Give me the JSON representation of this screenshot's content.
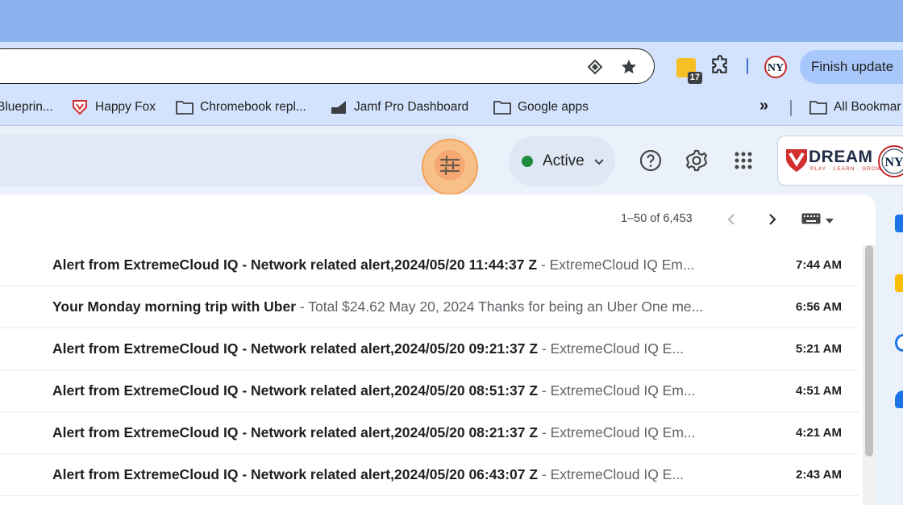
{
  "browser": {
    "finish_update_label": "Finish update",
    "calendar_badge_count": "17",
    "bookmarks": [
      {
        "label": "Blueprin...",
        "icon": "none"
      },
      {
        "label": "Happy Fox",
        "icon": "happyfox-shield-icon"
      },
      {
        "label": "Chromebook repl...",
        "icon": "folder-icon"
      },
      {
        "label": "Jamf Pro Dashboard",
        "icon": "jamf-icon"
      },
      {
        "label": "Google apps",
        "icon": "folder-icon"
      },
      {
        "label": "All Bookmar",
        "icon": "folder-icon"
      }
    ],
    "overflow_label": "»"
  },
  "gmail": {
    "status_label": "Active",
    "status_color": "#1e8e3e",
    "brand_name": "DREAM",
    "brand_tagline": "PLAY · LEARN · GROW",
    "pagination": "1–50 of 6,453",
    "emails": [
      {
        "subject": "Alert from ExtremeCloud IQ - Network related alert,2024/05/20 11:44:37 Z",
        "preview": " - ExtremeCloud IQ Em...",
        "time": "7:44 AM"
      },
      {
        "subject": "Your Monday morning trip with Uber",
        "preview": " - Total $24.62 May 20, 2024 Thanks for being an Uber One me...",
        "time": "6:56 AM"
      },
      {
        "subject": "Alert from ExtremeCloud IQ - Network related alert,2024/05/20 09:21:37 Z",
        "preview": " - ExtremeCloud IQ E...",
        "time": "5:21 AM"
      },
      {
        "subject": "Alert from ExtremeCloud IQ - Network related alert,2024/05/20 08:51:37 Z",
        "preview": " - ExtremeCloud IQ Em...",
        "time": "4:51 AM"
      },
      {
        "subject": "Alert from ExtremeCloud IQ - Network related alert,2024/05/20 08:21:37 Z",
        "preview": " - ExtremeCloud IQ Em...",
        "time": "4:21 AM"
      },
      {
        "subject": "Alert from ExtremeCloud IQ - Network related alert,2024/05/20 06:43:07 Z",
        "preview": " - ExtremeCloud IQ E...",
        "time": "2:43 AM"
      }
    ]
  },
  "colors": {
    "titlebar": "#8ab1ec",
    "toolbar": "#d3e3fd",
    "highlight": "#f5a158"
  }
}
